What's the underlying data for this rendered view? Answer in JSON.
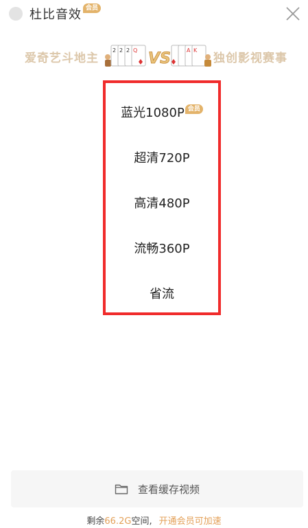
{
  "header": {
    "dolby_label": "杜比音效",
    "vip_badge": "会员",
    "close_icon": "close-icon"
  },
  "banner": {
    "left_text": "爱奇艺斗地主",
    "right_text": "独创影视赛事",
    "art_text": "VS",
    "card_left_ranks": [
      "2",
      "2",
      "2",
      "Q"
    ],
    "card_right_ranks": [
      "A",
      "K"
    ]
  },
  "quality": {
    "options": [
      {
        "label": "蓝光1080P",
        "badge": "会员"
      },
      {
        "label": "超清720P"
      },
      {
        "label": "高清480P"
      },
      {
        "label": "流畅360P"
      },
      {
        "label": "省流"
      }
    ],
    "highlight_color": "#f02b2b"
  },
  "footer": {
    "cache_button_label": "查看缓存视频",
    "folder_icon": "folder-icon",
    "storage_prefix": "剩余",
    "storage_amount": "66.2G",
    "storage_suffix": "空间,",
    "upgrade_link": "开通会员可加速"
  },
  "colors": {
    "accent": "#e3a058",
    "badge": "#e3b36a",
    "banner_text": "#dcc7aa"
  }
}
